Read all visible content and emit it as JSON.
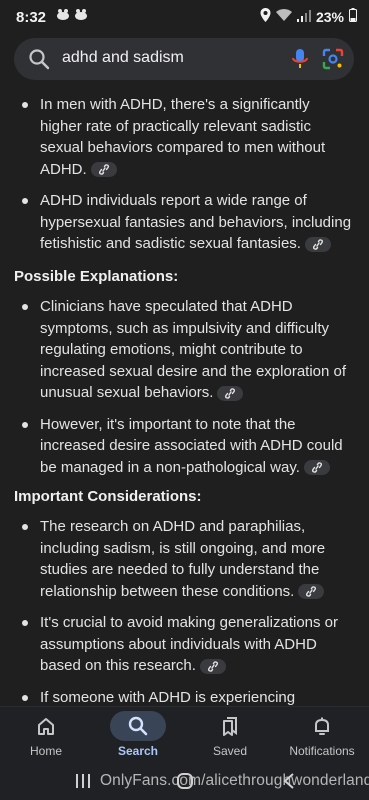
{
  "status_bar": {
    "time": "8:32",
    "battery": "23%"
  },
  "search": {
    "query": "adhd and sadism"
  },
  "sections": {
    "intro_items": [
      "In men with ADHD, there's a significantly higher rate of practically relevant sadistic sexual behaviors compared to men without ADHD.",
      "ADHD individuals report a wide range of hypersexual fantasies and behaviors, including fetishistic and sadistic sexual fantasies."
    ],
    "explanations": {
      "title": "Possible Explanations:",
      "items": [
        "Clinicians have speculated that ADHD symptoms, such as impulsivity and difficulty regulating emotions, might contribute to increased sexual desire and the exploration of unusual sexual behaviors.",
        "However, it's important to note that the increased desire associated with ADHD could be managed in a non-pathological way."
      ]
    },
    "considerations": {
      "title": "Important Considerations:",
      "items": [
        "The research on ADHD and paraphilias, including sadism, is still ongoing, and more studies are needed to fully understand the relationship between these conditions.",
        "It's crucial to avoid making generalizations or assumptions about individuals with ADHD based on this research.",
        "If someone with ADHD is experiencing unwanted or harmful sexual thoughts or"
      ]
    }
  },
  "bottom_nav": [
    {
      "label": "Home",
      "icon": "home-icon",
      "active": false
    },
    {
      "label": "Search",
      "icon": "search-icon",
      "active": true
    },
    {
      "label": "Saved",
      "icon": "saved-icon",
      "active": false
    },
    {
      "label": "Notifications",
      "icon": "bell-icon",
      "active": false
    }
  ],
  "watermark": "OnlyFans.com/alicethroughwonderland",
  "colors": {
    "background": "#1f1f1f",
    "accent": "#a8c7fa",
    "chip": "#3a3b3f"
  }
}
